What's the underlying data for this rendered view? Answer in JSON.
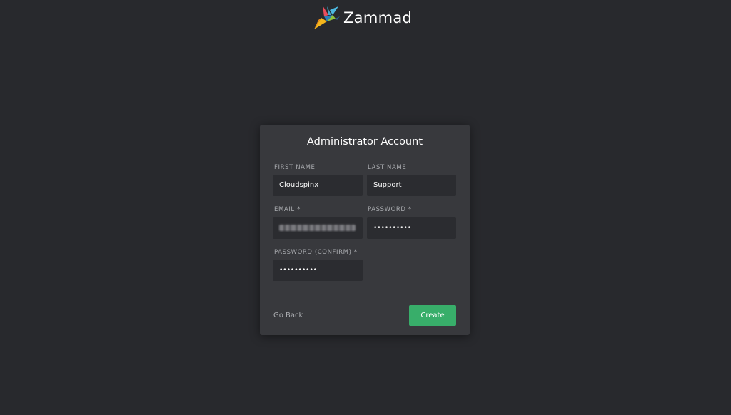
{
  "brand": {
    "name": "Zammad",
    "logo_icon": "zammad-bird-logo"
  },
  "form": {
    "title": "Administrator Account",
    "first_name": {
      "label": "FIRST NAME",
      "value": "Cloudspinx"
    },
    "last_name": {
      "label": "LAST NAME",
      "value": "Support"
    },
    "email": {
      "label": "EMAIL *",
      "value_state": "blurred"
    },
    "password": {
      "label": "PASSWORD *",
      "value": "••••••••••"
    },
    "password_confirm": {
      "label": "PASSWORD (CONFIRM) *",
      "value": "••••••••••"
    },
    "go_back_label": "Go Back",
    "create_label": "Create"
  },
  "colors": {
    "background": "#28292d",
    "card": "#38393d",
    "input": "#2b2c30",
    "accent_green": "#38ae6a"
  }
}
